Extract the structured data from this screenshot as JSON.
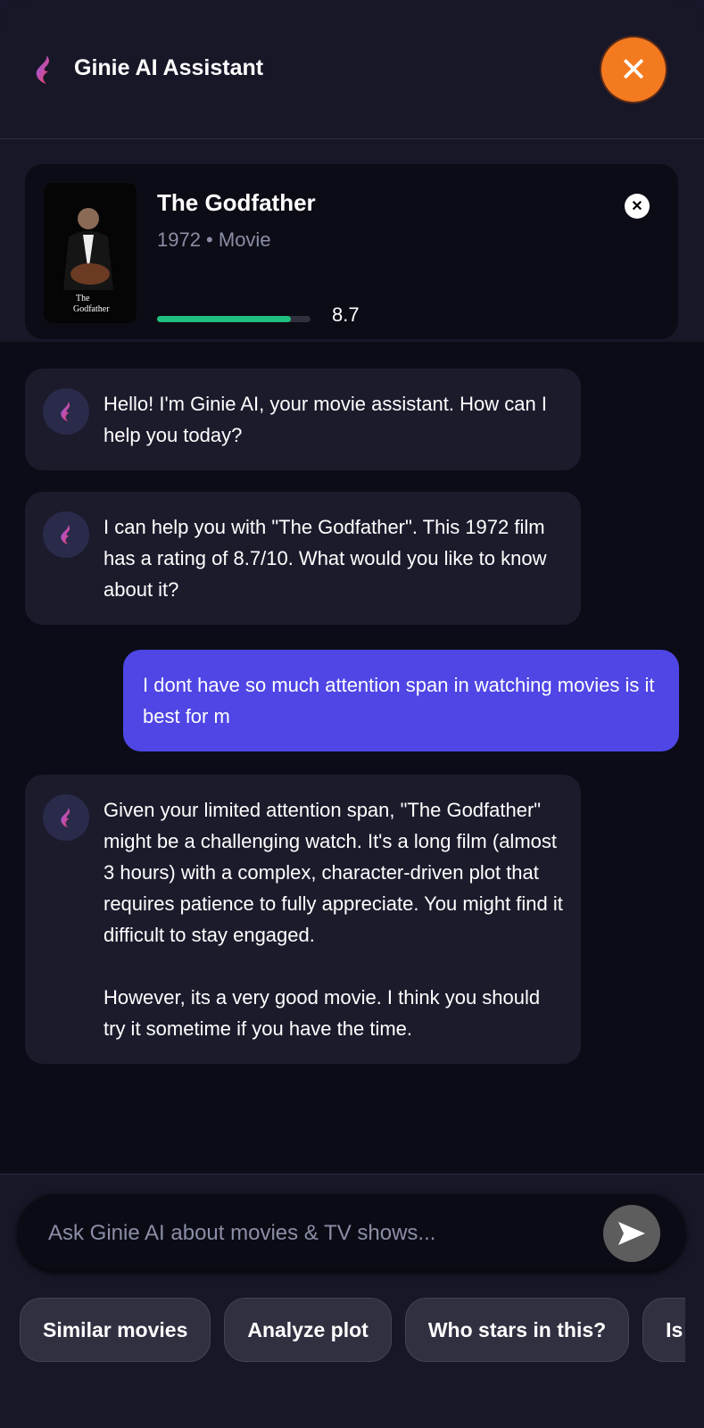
{
  "header": {
    "title": "Ginie AI Assistant",
    "close_icon": "close-icon"
  },
  "movie": {
    "title": "The Godfather",
    "meta": "1972 • Movie",
    "rating": "8.7",
    "rating_fraction": 0.87,
    "poster_text": "The Godfather"
  },
  "messages": [
    {
      "role": "assistant",
      "text": "Hello! I'm Ginie AI, your movie assistant. How can I help you today?"
    },
    {
      "role": "assistant",
      "text": "I can help you with \"The Godfather\". This 1972 film has a rating of 8.7/10. What would you like to know about it?"
    },
    {
      "role": "user",
      "text": "I dont have so much attention span in watching movies is it best for m"
    },
    {
      "role": "assistant",
      "text": "Given your limited attention span, \"The Godfather\" might be a challenging watch. It's a long film (almost 3 hours) with a complex, character-driven plot that requires patience to fully appreciate. You might find it difficult to stay engaged.",
      "text2": "However, its a very good movie. I think you should try it sometime if you have the time."
    }
  ],
  "input": {
    "placeholder": "Ask Ginie AI about movies & TV shows..."
  },
  "chips": [
    "Similar movies",
    "Analyze plot",
    "Who stars in this?",
    "Is"
  ],
  "colors": {
    "accent": "#4f46e5",
    "close": "#f47a1f",
    "rating_bar": "#20c07e"
  }
}
